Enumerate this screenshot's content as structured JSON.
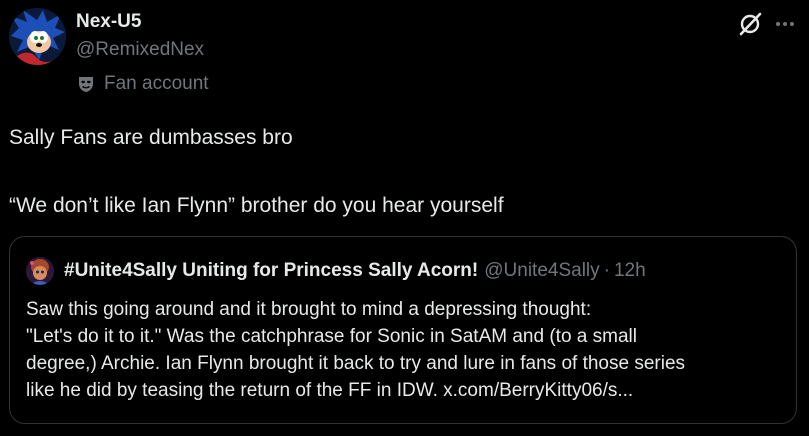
{
  "author": {
    "display_name": "Nex-U5",
    "handle": "@RemixedNex",
    "label": "Fan account",
    "label_icon": "mask-icon",
    "avatar_icon": "sonic-avatar"
  },
  "actions": {
    "grok_icon": "grok-icon",
    "more_icon": "more-icon"
  },
  "tweet": {
    "lines": [
      "Sally Fans are dumbasses bro",
      "“We don’t like Ian Flynn” brother do you hear yourself"
    ]
  },
  "quote": {
    "display_name": "#Unite4Sally Uniting for Princess Sally Acorn!",
    "handle": "@Unite4Sally",
    "separator": "·",
    "time": "12h",
    "lines": [
      "Saw this going around and it brought to mind a depressing thought:",
      "\"Let's do it to it.\" Was the catchphrase for Sonic in SatAM and (to a small",
      "degree,) Archie. Ian Flynn brought it back to try and lure in fans of those series",
      "like he did by teasing the return of the FF in IDW. x.com/BerryKitty06/s..."
    ]
  },
  "colors": {
    "background": "#000000",
    "text_primary": "#e7e9ea",
    "text_secondary": "#71767b",
    "border": "#2f3336"
  }
}
